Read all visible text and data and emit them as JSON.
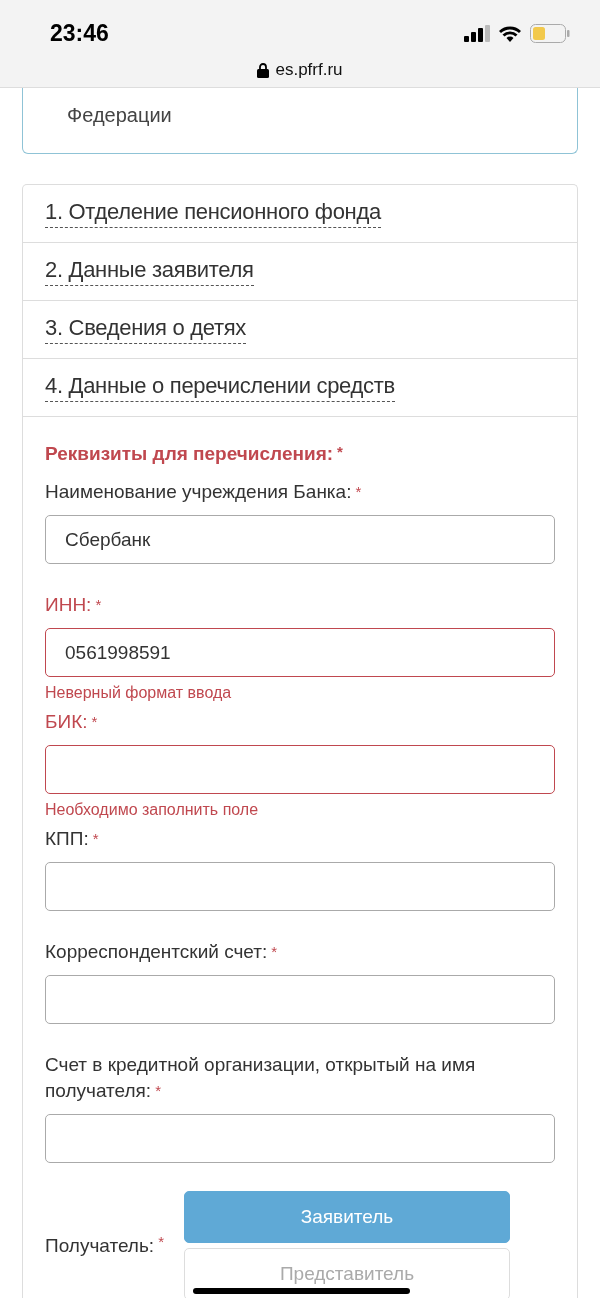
{
  "status_bar": {
    "time": "23:46",
    "url": "es.pfrf.ru"
  },
  "notice": {
    "text": "Федерации"
  },
  "steps": [
    {
      "label": "1. Отделение пенсионного фонда"
    },
    {
      "label": "2. Данные заявителя"
    },
    {
      "label": "3. Сведения о детях"
    },
    {
      "label": "4. Данные о перечислении средств"
    }
  ],
  "form": {
    "title": "Реквизиты для перечисления:",
    "required_mark": "*",
    "fields": [
      {
        "label": "Наименование учреждения Банка:",
        "value": "Сбербанк",
        "error": false
      },
      {
        "label": "ИНН:",
        "value": "0561998591",
        "error": true,
        "error_text": "Неверный формат ввода"
      },
      {
        "label": "БИК:",
        "error": true,
        "error_text": "Необходимо заполнить поле"
      },
      {
        "label": "КПП:",
        "error": false
      },
      {
        "label": "Корреспондентский счет:",
        "error": false
      },
      {
        "label": "Счет в кредитной организации, открытый на имя получателя:",
        "error": false
      }
    ],
    "recipient": {
      "label": "Получатель:",
      "options": [
        {
          "label": "Заявитель",
          "selected": true
        },
        {
          "label": "Представитель",
          "selected": false
        }
      ]
    }
  }
}
